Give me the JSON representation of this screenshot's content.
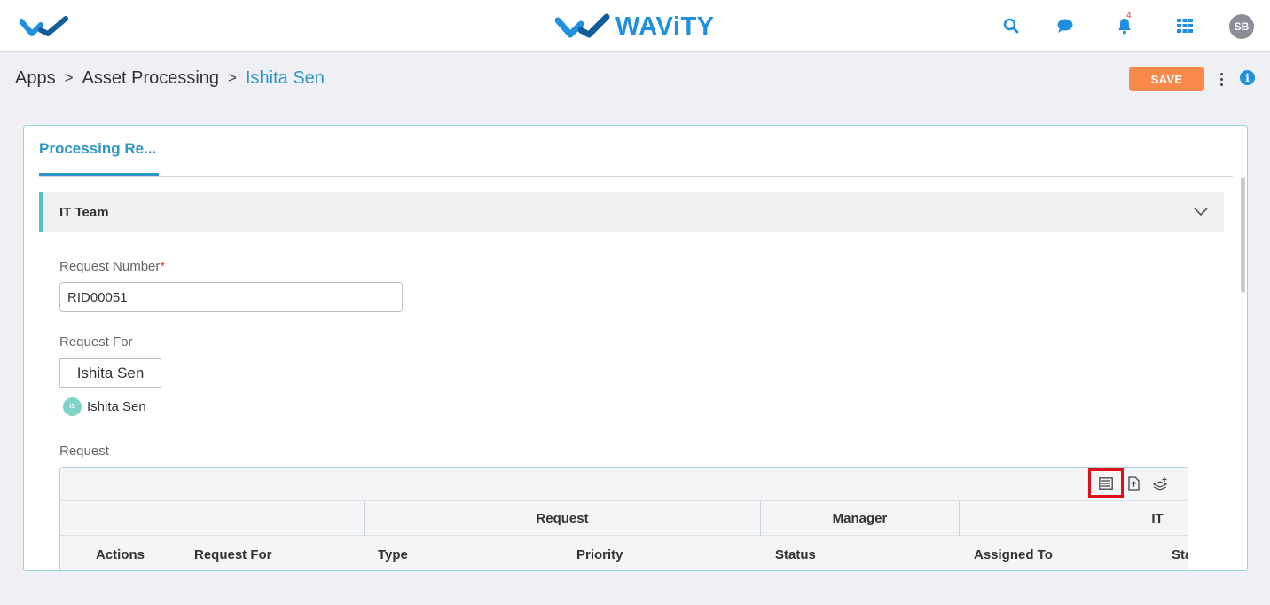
{
  "header": {
    "brand": "WAViTY",
    "notification_count": "4",
    "avatar_initials": "SB",
    "icons": [
      "wavity-logo-icon",
      "search-icon",
      "chat-icon",
      "bell-icon",
      "apps-grid-icon"
    ]
  },
  "breadcrumb": {
    "items": [
      "Apps",
      "Asset Processing",
      "Ishita Sen"
    ],
    "separator": ">"
  },
  "actions": {
    "save_label": "SAVE"
  },
  "tabs": [
    {
      "label": "Processing Re..."
    }
  ],
  "section": {
    "title": "IT Team"
  },
  "form": {
    "request_number_label": "Request Number",
    "request_number_required": "*",
    "request_number_value": "RID00051",
    "request_for_label": "Request For",
    "request_for_button": "Ishita Sen",
    "request_for_chip": {
      "initials": "IS",
      "name": "Ishita Sen"
    },
    "request_label": "Request"
  },
  "grid": {
    "toolbar_icons": [
      "list-view-icon",
      "export-file-icon",
      "layers-add-icon"
    ],
    "group_headers": [
      "Request",
      "Manager",
      "IT"
    ],
    "columns": [
      "Actions",
      "Request For",
      "Type",
      "Priority",
      "Status",
      "Assigned To",
      "Sta"
    ]
  },
  "colors": {
    "accent": "#2f95c8",
    "save": "#f9894a",
    "brand": "#1f8fe0",
    "section_bar": "#4fc3c8",
    "highlight": "#e0101a"
  }
}
